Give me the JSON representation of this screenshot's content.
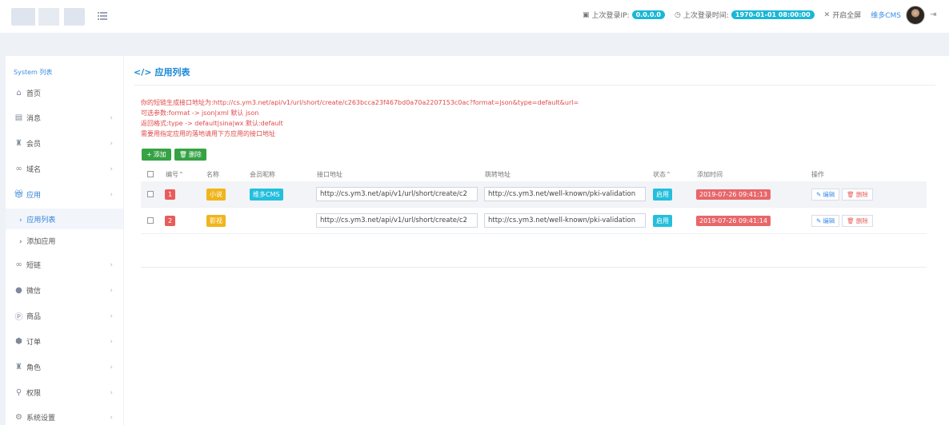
{
  "topbar": {
    "last_ip_label": "上次登录IP:",
    "last_ip_value": "0.0.0.0",
    "last_time_label": "上次登录时间:",
    "last_time_value": "1970-01-01 08:00:00",
    "fullscreen_label": "开启全屏",
    "user_name": "维多CMS",
    "icons": [
      "menu-icon",
      "ip-icon",
      "clock-icon",
      "fullscreen-icon",
      "logout-icon"
    ]
  },
  "sidebar": {
    "title": "System 列表",
    "items": [
      {
        "label": "首页",
        "icon": "home-icon",
        "chevron": false
      },
      {
        "label": "消息",
        "icon": "message-icon",
        "chevron": true
      },
      {
        "label": "会员",
        "icon": "member-icon",
        "chevron": true
      },
      {
        "label": "域名",
        "icon": "domain-icon",
        "chevron": true
      },
      {
        "label": "应用",
        "icon": "app-icon",
        "chevron": true,
        "active": true
      },
      {
        "label": "短链",
        "icon": "shortlink-icon",
        "chevron": true
      },
      {
        "label": "微信",
        "icon": "wechat-icon",
        "chevron": true
      },
      {
        "label": "商品",
        "icon": "product-icon",
        "chevron": true
      },
      {
        "label": "订单",
        "icon": "order-icon",
        "chevron": true
      },
      {
        "label": "角色",
        "icon": "role-icon",
        "chevron": true
      },
      {
        "label": "权限",
        "icon": "permission-icon",
        "chevron": true
      },
      {
        "label": "系统设置",
        "icon": "settings-icon",
        "chevron": true
      }
    ],
    "subitems": [
      {
        "label": "应用列表",
        "active": true
      },
      {
        "label": "添加应用",
        "active": false
      }
    ]
  },
  "main": {
    "title": "应用列表",
    "notes": [
      "你的短链生成接口地址为:http://cs.ym3.net/api/v1/url/short/create/c263bcca23f467bd0a70a2207153c0ac?format=json&type=default&url=",
      "可选参数:format -> json|xml 默认 json",
      "返回格式:type -> default|sina|wx 默认:default",
      "需要用指定应用的落地请用下方应用的接口地址"
    ],
    "buttons": {
      "add": "添加",
      "delete": "删除"
    },
    "table": {
      "headers": {
        "id": "编号",
        "name": "名称",
        "member": "会员昵称",
        "api": "接口地址",
        "jump": "跳转地址",
        "status": "状态",
        "time": "添加时间",
        "ops": "操作"
      },
      "rows": [
        {
          "id": "1",
          "name": "小说",
          "member": "维多CMS",
          "api": "http://cs.ym3.net/api/v1/url/short/create/c2",
          "jump": "http://cs.ym3.net/well-known/pki-validation",
          "status": "启用",
          "time": "2019-07-26 09:41:13",
          "edit": "编辑",
          "del": "删除"
        },
        {
          "id": "2",
          "name": "影视",
          "member": "",
          "api": "http://cs.ym3.net/api/v1/url/short/create/c2",
          "jump": "http://cs.ym3.net/well-known/pki-validation",
          "status": "启用",
          "time": "2019-07-26 09:41:14",
          "edit": "编辑",
          "del": "删除"
        }
      ]
    }
  },
  "colors": {
    "accent": "#1ab7d6",
    "brand_blue": "#2f7fd8",
    "danger": "#e85c5c",
    "success": "#35a244",
    "warning": "#f0b51c"
  }
}
